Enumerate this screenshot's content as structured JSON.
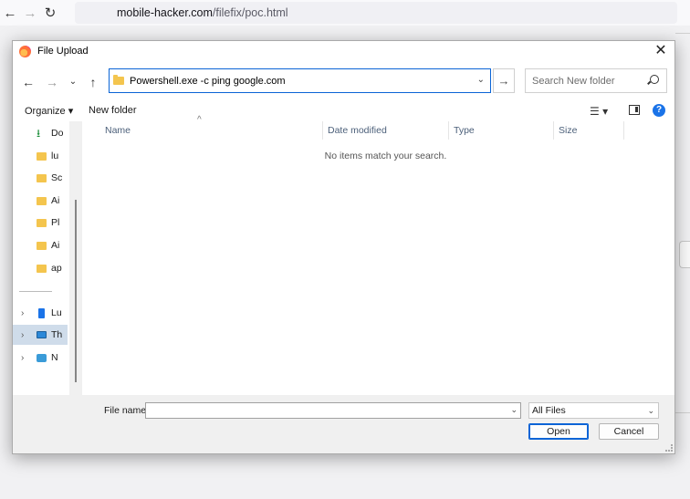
{
  "browser": {
    "back_icon": "←",
    "forward_icon": "→",
    "reload_icon": "↻",
    "url_host": "mobile-hacker.com",
    "url_path": "/filefix/poc.html"
  },
  "dialog": {
    "title": "File Upload",
    "close_icon": "✕",
    "address": "Powershell.exe -c ping google.com",
    "search_placeholder": "Search New folder",
    "organize_label": "Organize ▾",
    "new_folder_label": "New folder",
    "help_label": "?",
    "nav_items": [
      {
        "label": "Do",
        "icon": "download-icon"
      },
      {
        "label": "lu",
        "icon": "folder-icon"
      },
      {
        "label": "Sc",
        "icon": "folder-icon"
      },
      {
        "label": "Ai",
        "icon": "folder-icon"
      },
      {
        "label": "Pl",
        "icon": "folder-icon"
      },
      {
        "label": "Ai",
        "icon": "folder-icon"
      },
      {
        "label": "ap",
        "icon": "folder-icon"
      },
      {
        "label": "Lu",
        "icon": "phone-icon"
      },
      {
        "label": "Th",
        "icon": "pc-icon",
        "selected": true
      },
      {
        "label": "N",
        "icon": "network-icon"
      }
    ],
    "columns": [
      "Name",
      "Date modified",
      "Type",
      "Size"
    ],
    "empty_message": "No items match your search.",
    "file_name_label": "File name:",
    "file_name_value": "",
    "file_type": "All Files",
    "open_label": "Open",
    "cancel_label": "Cancel"
  }
}
